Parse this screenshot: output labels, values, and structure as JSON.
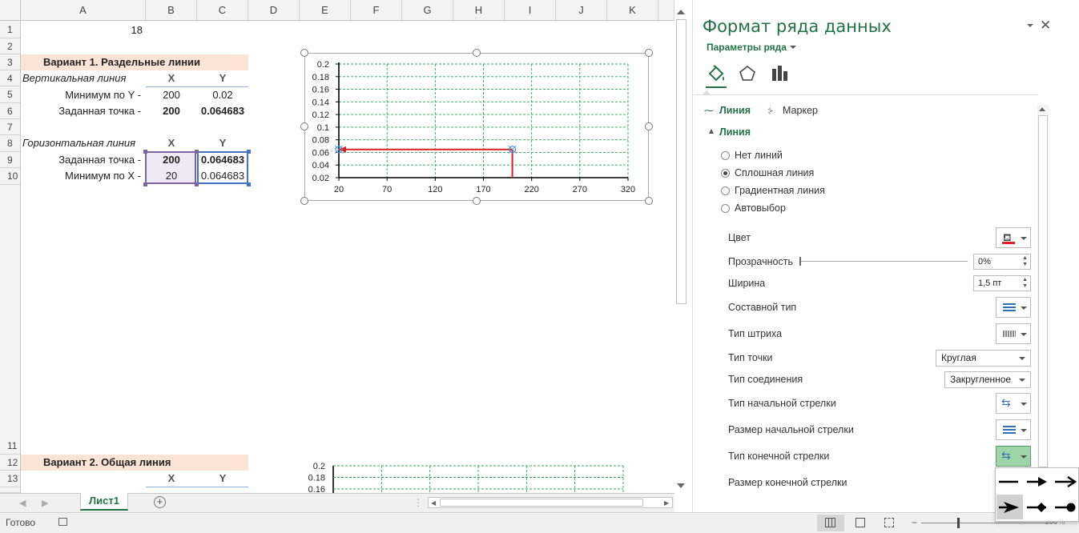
{
  "columns": [
    "A",
    "B",
    "C",
    "D",
    "E",
    "F",
    "G",
    "H",
    "I",
    "J",
    "K"
  ],
  "rows": [
    "1",
    "2",
    "3",
    "4",
    "5",
    "6",
    "7",
    "8",
    "9",
    "10",
    "11",
    "12",
    "13"
  ],
  "cells": {
    "a1": "18",
    "title1": "Вариант 1. Раздельные линии",
    "vert_label": "Вертикальная линия",
    "x_hdr": "X",
    "y_hdr": "Y",
    "min_y_label": "Минимум по Y -",
    "min_y_x": "200",
    "min_y_y": "0.02",
    "given_label": "Заданная точка -",
    "given_x": "200",
    "given_y": "0.064683",
    "horiz_label": "Горизонтальная линия",
    "given2_label": "Заданная точка -",
    "given2_x": "200",
    "given2_y": "0.064683",
    "min_x_label": "Минимум по X -",
    "min_x_x": "20",
    "min_x_y": "0.064683",
    "title2": "Вариант 2. Общая линия",
    "x_hdr2": "X",
    "y_hdr2": "Y"
  },
  "chart_data": [
    {
      "type": "scatter",
      "title": "",
      "xlabel": "",
      "ylabel": "",
      "xlim": [
        20,
        320
      ],
      "ylim": [
        0.02,
        0.2
      ],
      "x_ticks": [
        "20",
        "70",
        "120",
        "170",
        "220",
        "270",
        "320"
      ],
      "y_ticks": [
        "0.2",
        "0.18",
        "0.16",
        "0.14",
        "0.12",
        "0.1",
        "0.08",
        "0.06",
        "0.04",
        "0.02"
      ],
      "grid": true,
      "series": [
        {
          "points": [
            [
              200,
              0.02
            ],
            [
              200,
              0.064683
            ]
          ],
          "color": "#e02020"
        },
        {
          "points": [
            [
              200,
              0.064683
            ],
            [
              20,
              0.064683
            ]
          ],
          "color": "#e02020",
          "end_arrow": true
        }
      ]
    },
    {
      "type": "scatter",
      "title": "",
      "y_ticks": [
        "0.2",
        "0.18",
        "0.16"
      ],
      "grid": true
    }
  ],
  "sheet_tabs": {
    "active": "Лист1"
  },
  "status": {
    "ready": "Готово",
    "zoom": "100%"
  },
  "pane": {
    "title": "Формат ряда данных",
    "series_options": "Параметры ряда",
    "tab_line": "Линия",
    "tab_marker": "Маркер",
    "section": "Линия",
    "radio_none": "Нет линий",
    "radio_solid": "Сплошная линия",
    "radio_gradient": "Градиентная линия",
    "radio_auto": "Автовыбор",
    "color": "Цвет",
    "transparency": "Прозрачность",
    "transparency_value": "0%",
    "width": "Ширина",
    "width_value": "1,5 пт",
    "compound": "Составной тип",
    "dash": "Тип штриха",
    "cap": "Тип точки",
    "cap_value": "Круглая",
    "join": "Тип соединения",
    "join_value": "Закругленное",
    "begin_arrow": "Тип начальной стрелки",
    "begin_size": "Размер начальной стрелки",
    "end_arrow": "Тип конечной стрелки",
    "end_size": "Размер конечной стрелки"
  },
  "accent": "#217346"
}
